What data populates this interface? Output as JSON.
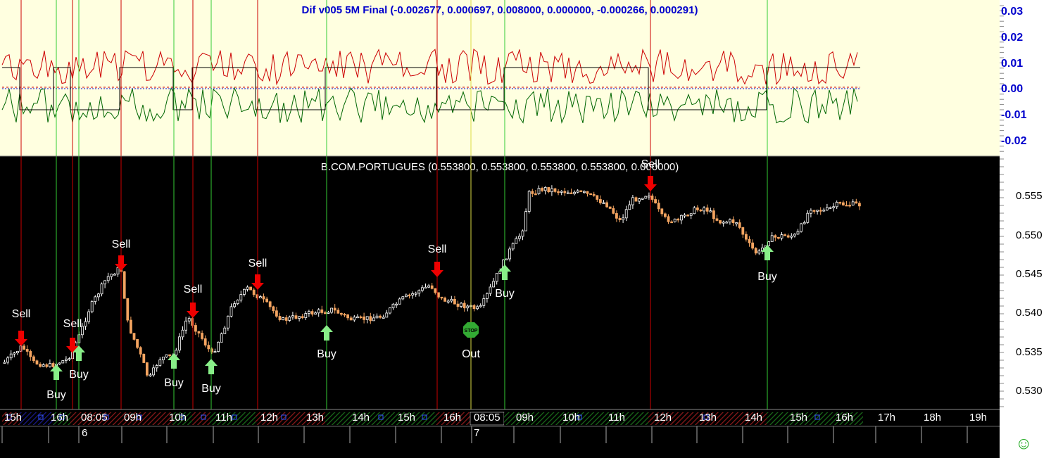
{
  "indicator": {
    "title": "Dif v005 5M Final (-0.002677, 0.000697, 0.008000, 0.000000, -0.000266, 0.000291)",
    "axis_labels": [
      "0.03",
      "0.02",
      "0.01",
      "0.00",
      "-0.01",
      "-0.02"
    ]
  },
  "price": {
    "title": "B.COM.PORTUGUES (0.553800, 0.553800, 0.553800, 0.553800, 0.000000)",
    "axis_labels": [
      "0.555",
      "0.550",
      "0.545",
      "0.540",
      "0.535",
      "0.530"
    ]
  },
  "signals": [
    {
      "label": "Sell",
      "type": "sell"
    },
    {
      "label": "Buy",
      "type": "buy"
    },
    {
      "label": "Sell",
      "type": "sell"
    },
    {
      "label": "Buy",
      "type": "buy"
    },
    {
      "label": "Sell",
      "type": "sell"
    },
    {
      "label": "Buy",
      "type": "buy"
    },
    {
      "label": "Sell",
      "type": "sell"
    },
    {
      "label": "Buy",
      "type": "buy"
    },
    {
      "label": "Sell",
      "type": "sell"
    },
    {
      "label": "Buy",
      "type": "buy"
    },
    {
      "label": "Sell",
      "type": "sell"
    },
    {
      "label": "Out",
      "type": "stop"
    },
    {
      "label": "Buy",
      "type": "buy"
    },
    {
      "label": "Sell",
      "type": "sell"
    },
    {
      "label": "Buy",
      "type": "buy"
    }
  ],
  "stop_icon_text": "STOP",
  "time_labels": [
    "15h",
    "16h",
    "08:05",
    "09h",
    "10h",
    "11h",
    "12h",
    "13h",
    "14h",
    "15h",
    "16h",
    "08:05",
    "09h",
    "10h",
    "11h",
    "12h",
    "13h",
    "14h",
    "15h",
    "16h",
    "17h",
    "18h",
    "19h"
  ],
  "day_labels": [
    "6",
    "7"
  ],
  "colors": {
    "sell": "#ee0000",
    "buy": "#88ee88",
    "buy_line": "#33cc33",
    "sell_line": "#cc0000",
    "indicator_bg": "#ffffe0",
    "bull": "#ffffff",
    "bear": "#f4a460"
  },
  "status_icon": "smiley-icon"
}
